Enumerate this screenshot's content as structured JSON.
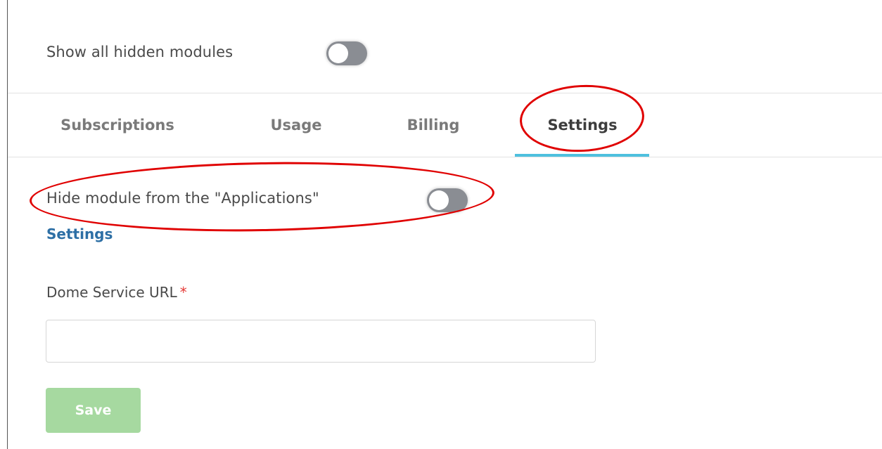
{
  "header": {
    "show_hidden_label": "Show all hidden modules",
    "show_hidden_enabled": false
  },
  "tabs": [
    {
      "label": "Subscriptions",
      "active": false
    },
    {
      "label": "Usage",
      "active": false
    },
    {
      "label": "Billing",
      "active": false
    },
    {
      "label": "Settings",
      "active": true
    }
  ],
  "settings_panel": {
    "hide_module_label": "Hide module from the \"Applications\"",
    "hide_module_enabled": false,
    "section_title": "Settings",
    "url_field": {
      "label": "Dome Service URL",
      "required_mark": "*",
      "value": "",
      "placeholder": ""
    },
    "save_label": "Save"
  },
  "colors": {
    "accent": "#4ec0de",
    "link": "#2d6fa5",
    "save_button_disabled": "#a6d9a0",
    "toggle_off": "#8a8d93",
    "annotation": "#e00000",
    "required": "#e53935"
  }
}
